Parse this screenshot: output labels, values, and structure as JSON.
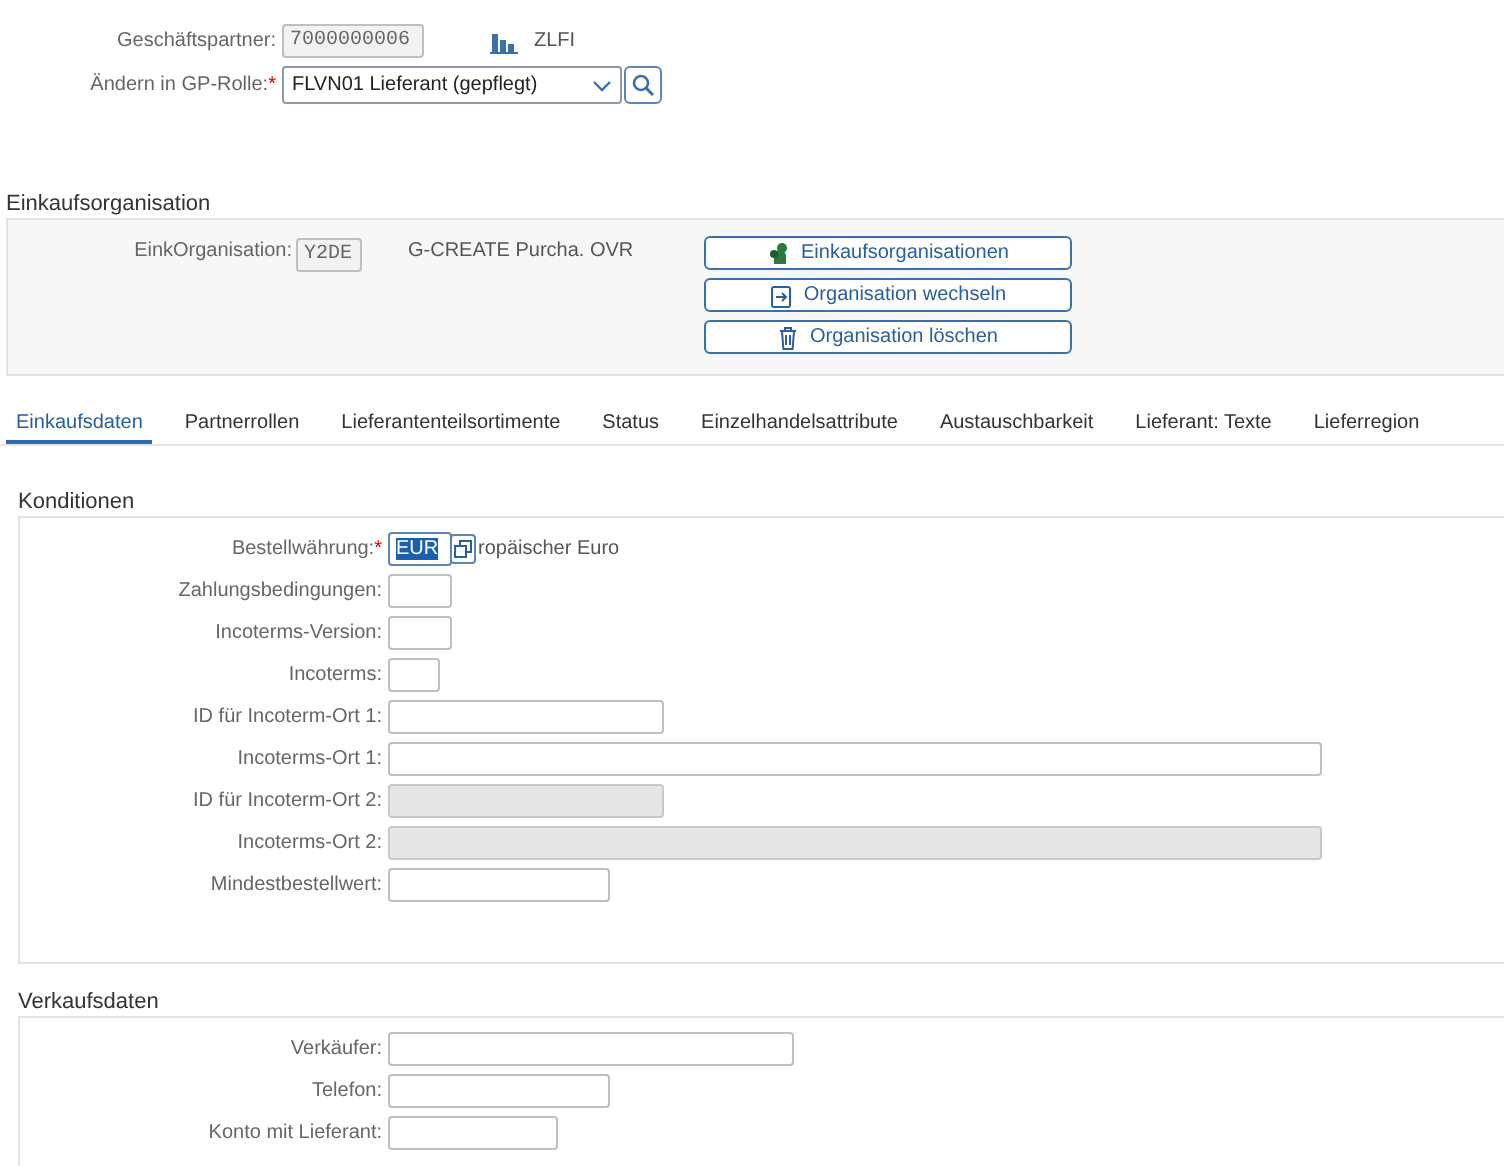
{
  "header": {
    "partner": {
      "label": "Geschäftspartner:",
      "value": "7000000006"
    },
    "partner_type": "ZLFI",
    "role": {
      "label": "Ändern in GP-Rolle:",
      "marker": "*",
      "value": "FLVN01 Lieferant (gepflegt)"
    }
  },
  "purchasing_org": {
    "title": "Einkaufsorganisation",
    "label": "EinkOrganisation:",
    "value": "Y2DE",
    "description": "G-CREATE Purcha. OVR",
    "buttons": [
      {
        "label": "Einkaufsorganisationen",
        "kind": "orgs"
      },
      {
        "label": "Organisation wechseln",
        "kind": "switch"
      },
      {
        "label": "Organisation löschen",
        "kind": "delete"
      }
    ]
  },
  "tabs": [
    {
      "label": "Einkaufsdaten",
      "selected": true
    },
    {
      "label": "Partnerrollen",
      "selected": false
    },
    {
      "label": "Lieferantenteilsortimente",
      "selected": false
    },
    {
      "label": "Status",
      "selected": false
    },
    {
      "label": "Einzelhandelsattribute",
      "selected": false
    },
    {
      "label": "Austauschbarkeit",
      "selected": false
    },
    {
      "label": "Lieferant: Texte",
      "selected": false
    },
    {
      "label": "Lieferregion",
      "selected": false
    }
  ],
  "sections": [
    {
      "title": "Konditionen",
      "fields": [
        {
          "label": "Bestellwährung:",
          "marker": "*",
          "disabled": false,
          "focused": true,
          "value": "EUR",
          "description": "ropäischer Euro"
        },
        {
          "label": "Zahlungsbedingungen:",
          "disabled": false,
          "focused": false
        },
        {
          "label": "Incoterms-Version:",
          "disabled": false,
          "focused": false
        },
        {
          "label": "Incoterms:",
          "disabled": false,
          "focused": false
        },
        {
          "label": "ID für Incoterm-Ort 1:",
          "disabled": false,
          "focused": false
        },
        {
          "label": "Incoterms-Ort 1:",
          "disabled": false,
          "focused": false
        },
        {
          "label": "ID für Incoterm-Ort 2:",
          "disabled": true,
          "focused": false
        },
        {
          "label": "Incoterms-Ort 2:",
          "disabled": true,
          "focused": false
        },
        {
          "label": "Mindestbestellwert:",
          "disabled": false,
          "focused": false
        }
      ]
    },
    {
      "title": "Verkaufsdaten",
      "fields": [
        {
          "label": "Verkäufer:",
          "disabled": false,
          "focused": false
        },
        {
          "label": "Telefon:",
          "disabled": false,
          "focused": false
        },
        {
          "label": "Konto mit Lieferant:",
          "disabled": false,
          "focused": false
        }
      ]
    }
  ]
}
